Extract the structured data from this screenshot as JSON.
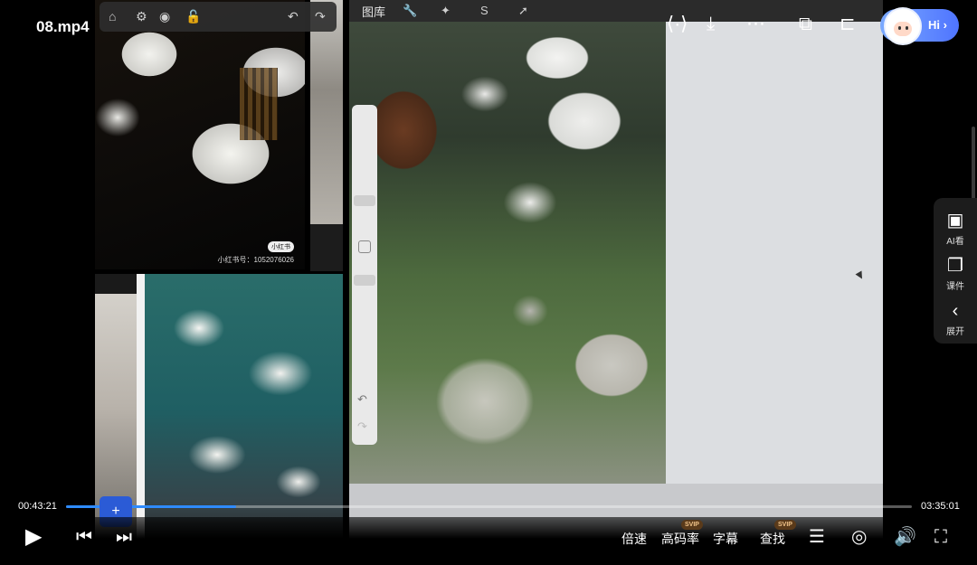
{
  "player": {
    "file_title": "08.mp4",
    "time_current": "00:43:21",
    "time_total": "03:35:01",
    "progress_fraction": 0.2016,
    "accent_color": "#2e8bff"
  },
  "controls": {
    "speed_label": "倍速",
    "bitrate_label": "高码率",
    "bitrate_badge": "SVIP",
    "subtitle_label": "字幕",
    "search_label": "查找",
    "search_badge": "SVIP",
    "add_label": "+"
  },
  "top_actions": {
    "hi_label": "Hi",
    "hi_chevron": "›"
  },
  "side_panel": {
    "items": [
      {
        "label": "AI看"
      },
      {
        "label": "课件"
      },
      {
        "label": "展开"
      }
    ]
  },
  "video_content": {
    "app_gallery_label": "图库",
    "night_photo_stamp": "小红书",
    "night_photo_caption": "小红书号：1052076026"
  }
}
